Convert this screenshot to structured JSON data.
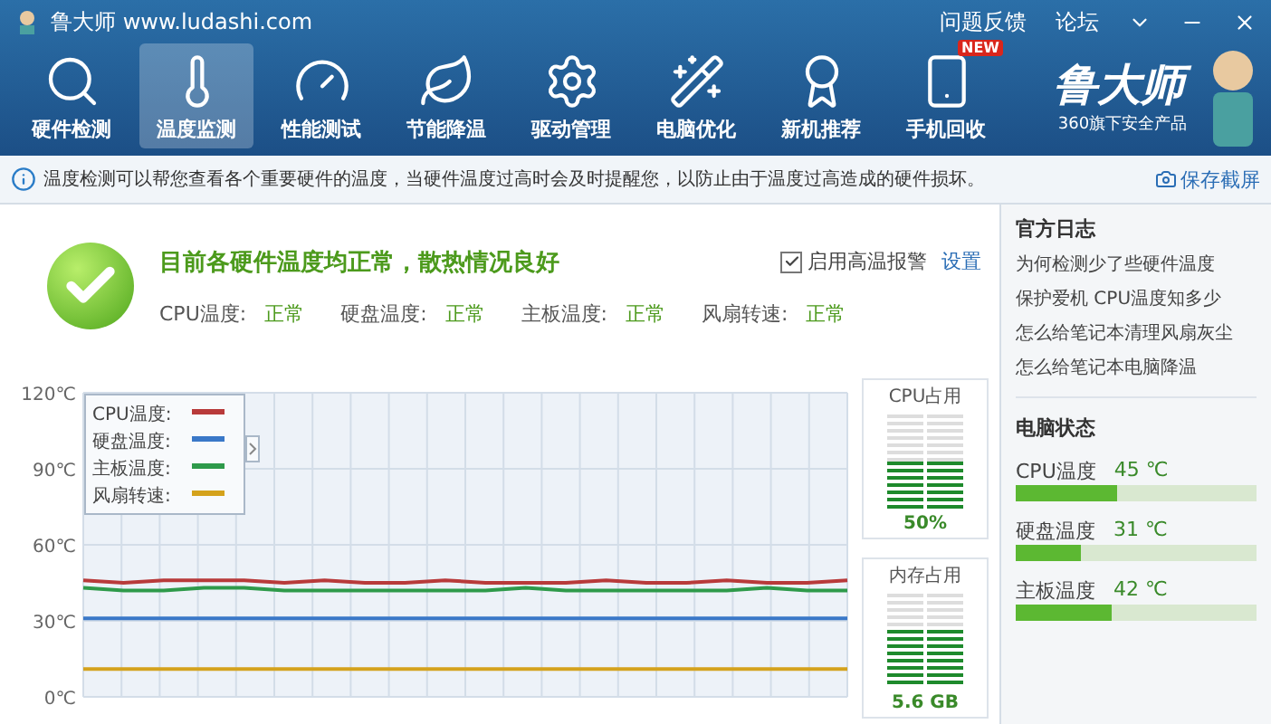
{
  "window": {
    "title": "鲁大师 www.ludashi.com",
    "links": [
      "问题反馈",
      "论坛"
    ]
  },
  "nav": [
    {
      "label": "硬件检测",
      "selected": false
    },
    {
      "label": "温度监测",
      "selected": true
    },
    {
      "label": "性能测试",
      "selected": false
    },
    {
      "label": "节能降温",
      "selected": false
    },
    {
      "label": "驱动管理",
      "selected": false
    },
    {
      "label": "电脑优化",
      "selected": false
    },
    {
      "label": "新机推荐",
      "selected": false
    },
    {
      "label": "手机回收",
      "selected": false,
      "badge": "NEW"
    }
  ],
  "brand": {
    "name": "鲁大师",
    "tagline": "360旗下安全产品"
  },
  "info_bar": {
    "message": "温度检测可以帮您查看各个重要硬件的温度，当硬件温度过高时会及时提醒您，以防止由于温度过高造成的硬件损坏。",
    "action": "保存截屏"
  },
  "status": {
    "headline": "目前各硬件温度均正常，散热情况良好",
    "alarm": {
      "label": "启用高温报警",
      "checked": true
    },
    "settings": "设置",
    "items": [
      {
        "label": "CPU温度:",
        "value": "正常"
      },
      {
        "label": "硬盘温度:",
        "value": "正常"
      },
      {
        "label": "主板温度:",
        "value": "正常"
      },
      {
        "label": "风扇转速:",
        "value": "正常"
      }
    ]
  },
  "chart": {
    "chart_data": {
      "type": "line",
      "grid": true,
      "legend": true,
      "ylim": [
        0,
        120
      ],
      "yticks": [
        {
          "value": 0,
          "label": "0℃"
        },
        {
          "value": 30,
          "label": "30℃"
        },
        {
          "value": 60,
          "label": "60℃"
        },
        {
          "value": 90,
          "label": "90℃"
        },
        {
          "value": 120,
          "label": "120℃"
        }
      ],
      "series": [
        {
          "name": "CPU温度:",
          "color": "#b83a3a",
          "values": [
            46,
            45,
            46,
            46,
            46,
            45,
            46,
            45,
            45,
            46,
            45,
            45,
            45,
            46,
            45,
            45,
            46,
            45,
            45,
            46
          ]
        },
        {
          "name": "硬盘温度:",
          "color": "#3a78c8",
          "values": [
            31,
            31,
            31,
            31,
            31,
            31,
            31,
            31,
            31,
            31,
            31,
            31,
            31,
            31,
            31,
            31,
            31,
            31,
            31,
            31
          ]
        },
        {
          "name": "主板温度:",
          "color": "#2e9a4a",
          "values": [
            43,
            42,
            42,
            43,
            43,
            42,
            42,
            42,
            42,
            42,
            42,
            43,
            42,
            42,
            42,
            42,
            42,
            43,
            42,
            42
          ]
        },
        {
          "name": "风扇转速:",
          "color": "#d4a21c",
          "values": [
            11,
            11,
            11,
            11,
            11,
            11,
            11,
            11,
            11,
            11,
            11,
            11,
            11,
            11,
            11,
            11,
            11,
            11,
            11,
            11
          ]
        }
      ]
    }
  },
  "meters": [
    {
      "title": "CPU占用",
      "level": 0.5,
      "reading": "50%"
    },
    {
      "title": "内存占用",
      "level": 0.62,
      "reading": "5.6 GB"
    }
  ],
  "sidebar": {
    "news_title": "官方日志",
    "news": [
      "为何检测少了些硬件温度",
      "保护爱机 CPU温度知多少",
      "怎么给笔记本清理风扇灰尘",
      "怎么给笔记本电脑降温"
    ],
    "state_title": "电脑状态",
    "states": [
      {
        "label": "CPU温度",
        "reading": "45 ℃",
        "level": 0.42
      },
      {
        "label": "硬盘温度",
        "reading": "31 ℃",
        "level": 0.27
      },
      {
        "label": "主板温度",
        "reading": "42 ℃",
        "level": 0.4
      }
    ]
  }
}
